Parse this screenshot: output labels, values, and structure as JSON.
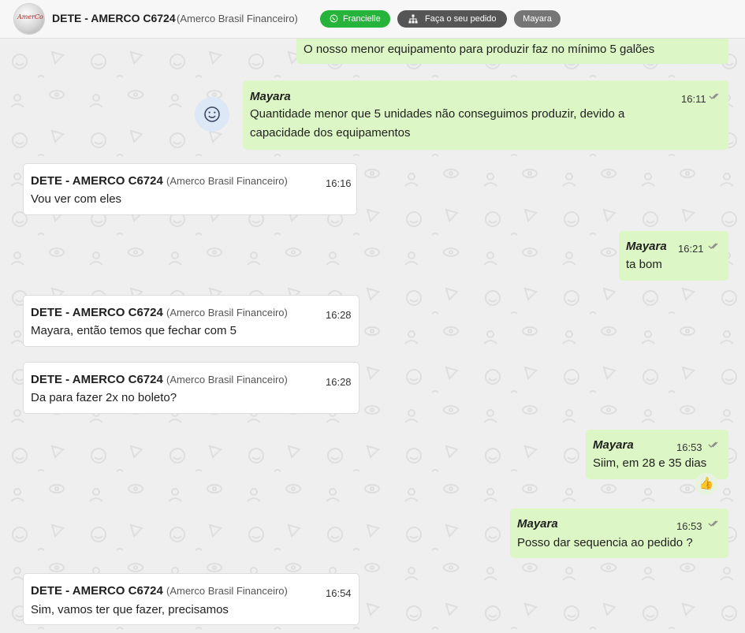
{
  "header": {
    "title": "DETE - AMERCO C6724",
    "subtitle": "(Amerco Brasil Financeiro)",
    "logo_text": "AmerCo",
    "pill_whatsapp": "Francielle",
    "pill_order": "Faça o seu pedido",
    "pill_user": "Mayara"
  },
  "messages": [
    {
      "direction": "out",
      "text": "O nosso menor equipamento para produzir faz no mínimo 5 galões"
    },
    {
      "direction": "out",
      "sender": "Mayara",
      "time": "16:11",
      "line1": "Quantidade menor que 5 unidades não conseguimos produzir, devido a",
      "line2": "capacidade dos equipamentos"
    },
    {
      "direction": "in",
      "sender": "DETE - AMERCO C6724",
      "org": "(Amerco Brasil Financeiro)",
      "time": "16:16",
      "text": "Vou ver com eles"
    },
    {
      "direction": "out",
      "sender": "Mayara",
      "time": "16:21",
      "text": "ta bom"
    },
    {
      "direction": "in",
      "sender": "DETE - AMERCO C6724",
      "org": "(Amerco Brasil Financeiro)",
      "time": "16:28",
      "text": "Mayara, então temos que fechar com 5"
    },
    {
      "direction": "in",
      "sender": "DETE - AMERCO C6724",
      "org": "(Amerco Brasil Financeiro)",
      "time": "16:28",
      "text": "Da para fazer 2x no boleto?"
    },
    {
      "direction": "out",
      "sender": "Mayara",
      "time": "16:53",
      "text": "Siim, em 28 e 35 dias",
      "reaction": "👍"
    },
    {
      "direction": "out",
      "sender": "Mayara",
      "time": "16:53",
      "text": "Posso dar sequencia ao pedido ?"
    },
    {
      "direction": "in",
      "sender": "DETE - AMERCO C6724",
      "org": "(Amerco Brasil Financeiro)",
      "time": "16:54",
      "text": "Sim, vamos ter que fazer, precisamos"
    }
  ],
  "icons": {
    "whatsapp": "whatsapp-icon",
    "order": "sitemap-icon",
    "read": "double-check-icon",
    "emoji": "smiley-icon"
  },
  "colors": {
    "incoming_bubble": "#ffffff",
    "outgoing_bubble": "#dcf7c5",
    "whatsapp_green": "#25b339",
    "chat_background": "#efefef"
  }
}
